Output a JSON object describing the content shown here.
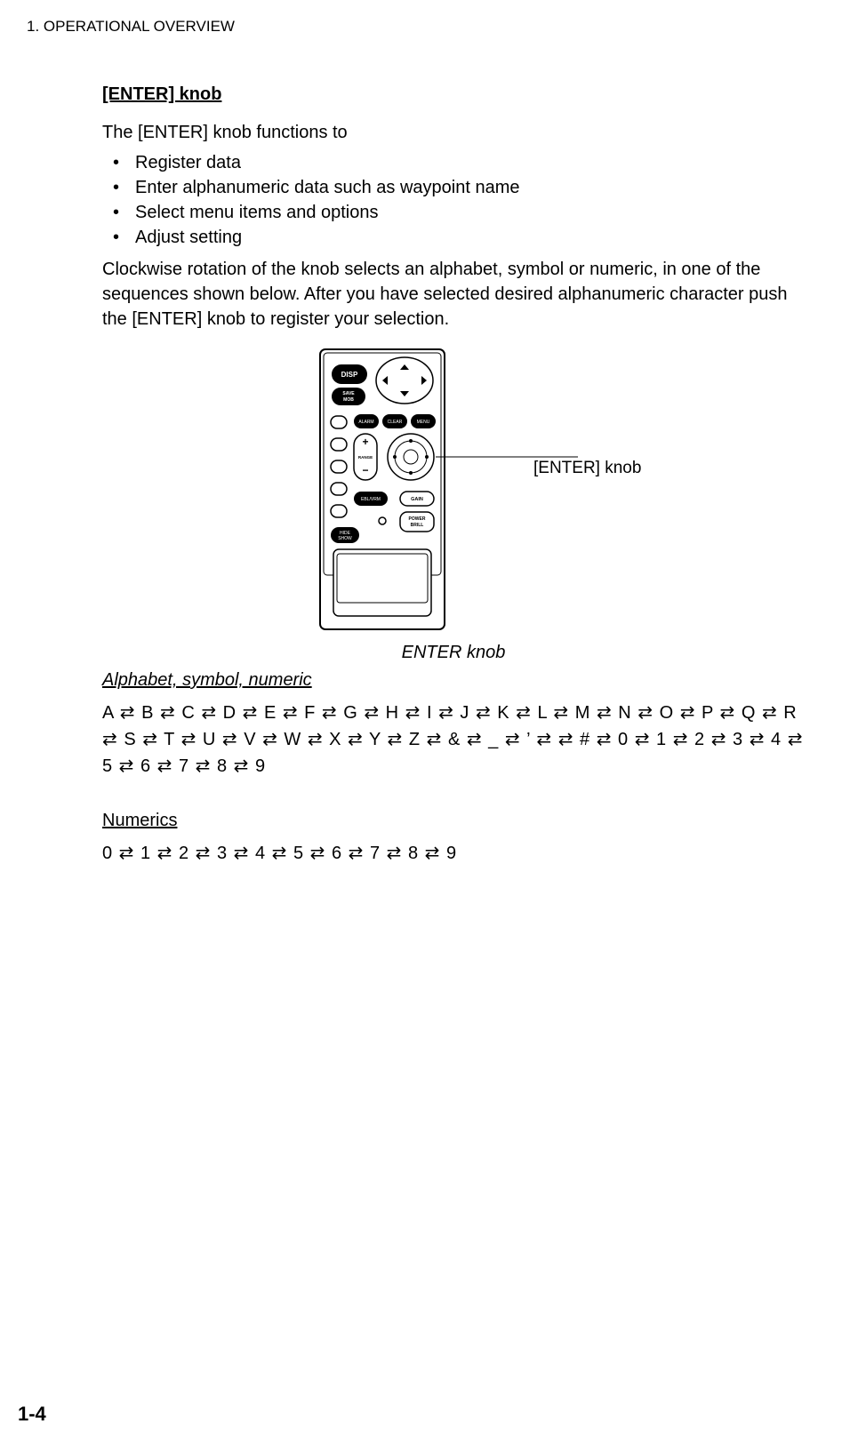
{
  "header": "1. OPERATIONAL OVERVIEW",
  "section_title": "[ENTER] knob",
  "intro": "The [ENTER] knob functions to",
  "bullets": [
    "Register data",
    "Enter alphanumeric data such as waypoint name",
    "Select menu items and options",
    "Adjust setting"
  ],
  "para1": "Clockwise rotation of the knob selects an alphabet, symbol or numeric, in one of the sequences shown below. After you have selected desired alphanumeric character push the [ENTER] knob to register your selection.",
  "callout": "[ENTER] knob",
  "figure_caption": "ENTER knob",
  "sub1": "Alphabet, symbol, numeric",
  "seq1_chars": [
    "A",
    "B",
    "C",
    "D",
    "E",
    "F",
    "G",
    "H",
    "I",
    "J",
    "K",
    "L",
    "M",
    "N",
    "O",
    "P",
    "Q",
    "R",
    "S",
    "T",
    "U",
    "V",
    "W",
    "X",
    "Y",
    "Z",
    "&",
    "_",
    "’",
    " ",
    "#",
    "0",
    "1",
    "2",
    "3",
    "4",
    "5",
    "6",
    "7",
    "8",
    "9"
  ],
  "sub2": "Numerics",
  "seq2_chars": [
    "0",
    "1",
    "2",
    "3",
    "4",
    "5",
    "6",
    "7",
    "8",
    "9"
  ],
  "page_number": "1-4",
  "device_labels": {
    "disp": "DISP",
    "save_mob": "SAVE MOB",
    "alarm": "ALARM",
    "clear": "CLEAR",
    "menu": "MENU",
    "range": "RANGE",
    "ebl_vrm": "EBL/VRM",
    "gain": "GAIN",
    "power_brill": "POWER BRILL",
    "hide_show": "HIDE SHOW"
  }
}
